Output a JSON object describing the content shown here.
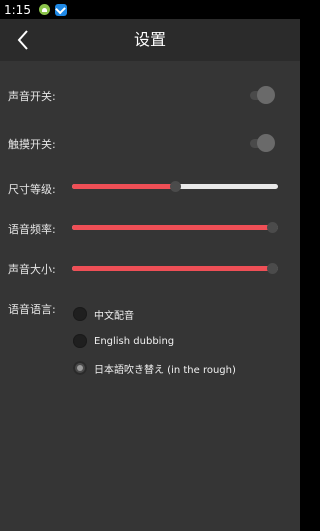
{
  "status_bar": {
    "time": "1:15",
    "icons": [
      "android-icon",
      "app-notification-icon"
    ]
  },
  "header": {
    "title": "设置",
    "back_icon": "chevron-left-icon"
  },
  "settings": {
    "sound_label": "声音开关:",
    "sound_on": false,
    "touch_label": "触摸开关:",
    "touch_on": false,
    "size_label": "尺寸等级:",
    "size_level": 0.5,
    "freq_label": "语音频率:",
    "freq_level": 0.97,
    "volume_label": "声音大小:",
    "volume_level": 0.97,
    "language_label": "语音语言:",
    "languages": [
      "中文配音",
      "English dubbing",
      "日本語吹き替え (in the rough)"
    ],
    "selected_language_index": 2
  },
  "colors": {
    "accent": "#ef4f56",
    "appbar": "#2b2b2b",
    "background": "#353535"
  }
}
